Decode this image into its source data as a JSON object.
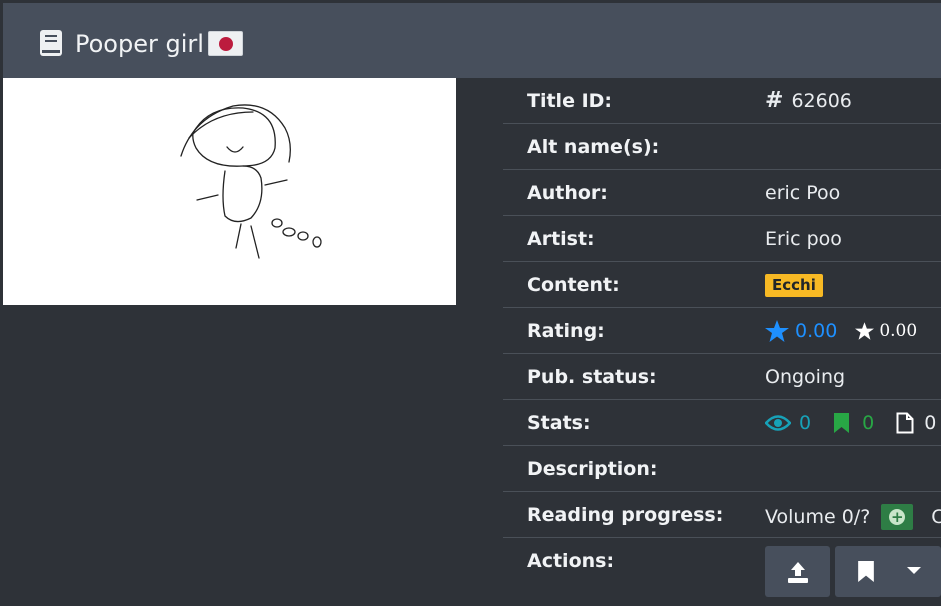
{
  "header": {
    "title": "Pooper girl",
    "icon": "book-icon",
    "flag": "japan-flag"
  },
  "info": {
    "title_id": {
      "label": "Title ID:",
      "value": "62606"
    },
    "alt_names": {
      "label": "Alt name(s):",
      "value": ""
    },
    "author": {
      "label": "Author:",
      "value": "eric Poo"
    },
    "artist": {
      "label": "Artist:",
      "value": "Eric poo"
    },
    "content": {
      "label": "Content:",
      "value": "Ecchi"
    },
    "rating": {
      "label": "Rating:",
      "bayesian": "0.00",
      "mean": "0.00"
    },
    "pub_status": {
      "label": "Pub. status:",
      "value": "Ongoing"
    },
    "stats": {
      "label": "Stats:",
      "views": "0",
      "follows": "0",
      "chapters": "0"
    },
    "description": {
      "label": "Description:",
      "value": ""
    },
    "reading_progress": {
      "label": "Reading progress:",
      "volume": "Volume 0/?",
      "chapter_initial": "C"
    },
    "actions": {
      "label": "Actions:"
    }
  },
  "colors": {
    "header_bg": "#474f5c",
    "page_bg": "#2e3238",
    "badge": "#f7b924",
    "rating_blue": "#1e90ff",
    "stat_teal": "#17a2b8",
    "stat_green": "#28a745"
  }
}
